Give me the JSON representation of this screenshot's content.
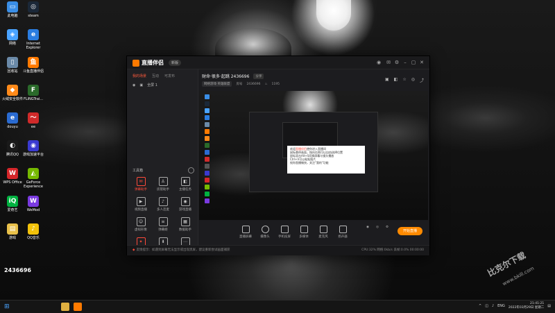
{
  "desktop": {
    "icons": [
      {
        "label": "此电脑",
        "color": "#3a8ee6",
        "glyph": "▭"
      },
      {
        "label": "steam",
        "color": "#1b2838",
        "glyph": "◎"
      },
      {
        "label": "网络",
        "color": "#4aa3ff",
        "glyph": "◈"
      },
      {
        "label": "Internet Explorer",
        "color": "#2a7de1",
        "glyph": "e"
      },
      {
        "label": "回收站",
        "color": "#6b8aa8",
        "glyph": "▯"
      },
      {
        "label": "斗鱼直播伴侣",
        "color": "#ff7a00",
        "glyph": "鱼"
      },
      {
        "label": "火绒安全软件",
        "color": "#ff8a1a",
        "glyph": "◆"
      },
      {
        "label": "FLiNGTrai...",
        "color": "#2a6a2a",
        "glyph": "F"
      },
      {
        "label": "douyu",
        "color": "#2a6bd1",
        "glyph": "e"
      },
      {
        "label": "ee",
        "color": "#d02a2a",
        "glyph": "〜"
      },
      {
        "label": "腾讯QQ",
        "color": "#1a1a1a",
        "glyph": "◐"
      },
      {
        "label": "游戏加速平台",
        "color": "#3a3ad0",
        "glyph": "◉"
      },
      {
        "label": "WPS Office",
        "color": "#d6262a",
        "glyph": "W"
      },
      {
        "label": "GeForce Experience",
        "color": "#76b900",
        "glyph": "◭"
      },
      {
        "label": "爱奇艺",
        "color": "#00b140",
        "glyph": "iQ"
      },
      {
        "label": "WeMod",
        "color": "#7a3ae0",
        "glyph": "W"
      },
      {
        "label": "游戏",
        "color": "#e8c04a",
        "glyph": "▤"
      },
      {
        "label": "QQ音乐",
        "color": "#f2c20a",
        "glyph": "♪"
      }
    ],
    "room_number": "2436696",
    "watermark": "比克尔下载",
    "watermark_url": "www.bkill.com"
  },
  "app": {
    "name": "直播伴侣",
    "version": "新版",
    "sidebar_tabs": [
      "我的场景",
      "互动",
      "可发布"
    ],
    "scene_label": "全屏 1",
    "tools_label": "工具箱",
    "tools": [
      {
        "label": "弹幕助手",
        "hot": true
      },
      {
        "label": "房管助手",
        "hot": false
      },
      {
        "label": "主播任务",
        "hot": false
      },
      {
        "label": "视频直播",
        "hot": false
      },
      {
        "label": "多人连麦",
        "hot": false
      },
      {
        "label": "游戏直播",
        "hot": false
      },
      {
        "label": "虚拟形象",
        "hot": false
      },
      {
        "label": "弹幕姬",
        "hot": false
      },
      {
        "label": "数据助手",
        "hot": false
      },
      {
        "label": "PK",
        "hot": true
      },
      {
        "label": "下载",
        "hot": false
      },
      {
        "label": "更多",
        "hot": false
      }
    ],
    "room_title": "财命·很多·起跳 2436696",
    "room_tag": "分享",
    "sub_tag": "网络游戏·英雄联盟",
    "sub_extra": "房号",
    "sub_room": "2436696",
    "sub_heat": "1195",
    "bottom_buttons": [
      "直播屏幕",
      "摄像头",
      "手机投屏",
      "多媒体",
      "麦克风",
      "扬声器"
    ],
    "live_button": "开始直播",
    "status_warn": "友情提示：",
    "status_text": "如遇到屏幕无法显示或出现黑屏，建议重新尝试画面捕获",
    "status_stats": "CPU:32%  网络:0kb/s  丢帧:0.0%  00:00:00"
  },
  "welcome_box": {
    "line1_prefix": "欢迎",
    "line1_highlight": "直播伴侣",
    "line1_suffix": "使你进入直播间",
    "lines": [
      "鼠标悬停画面，指向右侧可以自由选择位置",
      "鼠标双击Alt+S切换屏幕与镜头播放",
      "Ctrl+V可以粘贴图片",
      "祝你直播愉快，关注\"我的\"功能"
    ]
  },
  "taskbar": {
    "lang": "ENG",
    "time": "21:41:21",
    "date": "2022年03月29日 星期二"
  },
  "colors": {
    "accent": "#ff7a00",
    "hot": "#ff4a3a"
  }
}
